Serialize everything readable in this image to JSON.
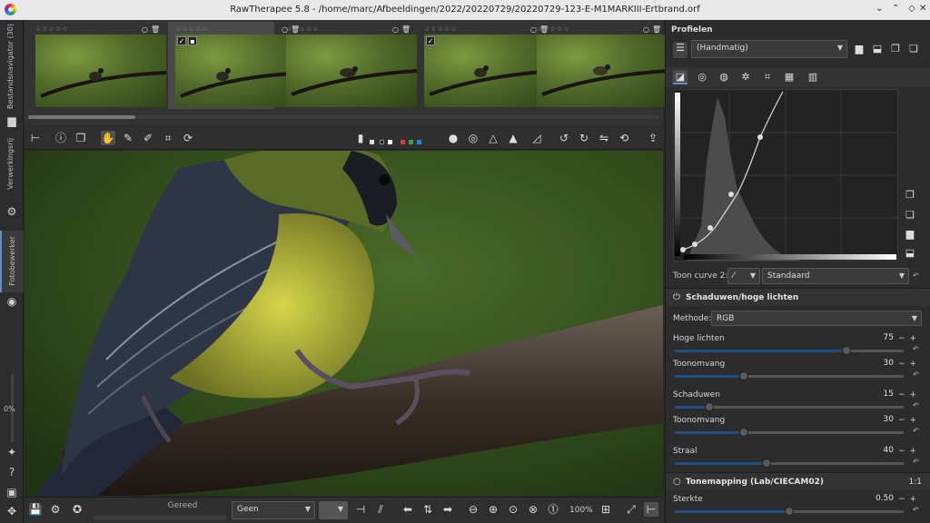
{
  "window": {
    "title": "RawTherapee 5.8 - /home/marc/Afbeeldingen/2022/20220729/20220729-123-E-M1MARKIII-Ertbrand.orf"
  },
  "left_tabs": {
    "file_browser": "Bestandsnavigator (30)",
    "queue": "Verwerkingsrij",
    "editor": "Fotobewerker",
    "zoom_percent": "0%"
  },
  "filmstrip": {
    "thumbnails": [
      {
        "rating": "☆☆☆☆☆",
        "selected": false
      },
      {
        "rating": "☆☆☆☆☆",
        "selected": true
      },
      {
        "rating": "☆☆☆☆☆",
        "selected": false
      },
      {
        "rating": "☆☆☆☆☆",
        "selected": false
      },
      {
        "rating": "☆☆☆☆☆",
        "selected": false
      }
    ]
  },
  "bottom": {
    "status": "Gereed",
    "preview_mode": "Geen",
    "zoom": "100%"
  },
  "right": {
    "profiles_title": "Profielen",
    "profile_value": "(Handmatig)",
    "tone_curve_2_label": "Toon curve 2:",
    "tone_curve_2_value": "Standaard",
    "sections": {
      "shadows_highlights": "Schaduwen/hoge lichten",
      "tonemapping": "Tonemapping (Lab/CIECAM02)",
      "tonemapping_extra": "1:1"
    },
    "method_label": "Methode:",
    "method_value": "RGB",
    "sliders": [
      {
        "label": "Hoge lichten",
        "value": "75",
        "fraction": 0.75
      },
      {
        "label": "Toonomvang",
        "value": "30",
        "fraction": 0.3
      },
      {
        "label": "Schaduwen",
        "value": "15",
        "fraction": 0.15
      },
      {
        "label": "Toonomvang",
        "value": "30",
        "fraction": 0.3
      },
      {
        "label": "Straal",
        "value": "40",
        "fraction": 0.4
      },
      {
        "label": "Sterkte",
        "value": "0.50",
        "fraction": 0.5
      }
    ]
  },
  "colors": {
    "accent": "#1f4f86",
    "panel": "#2c2c2c",
    "tab_active": "#5a8fd0"
  }
}
